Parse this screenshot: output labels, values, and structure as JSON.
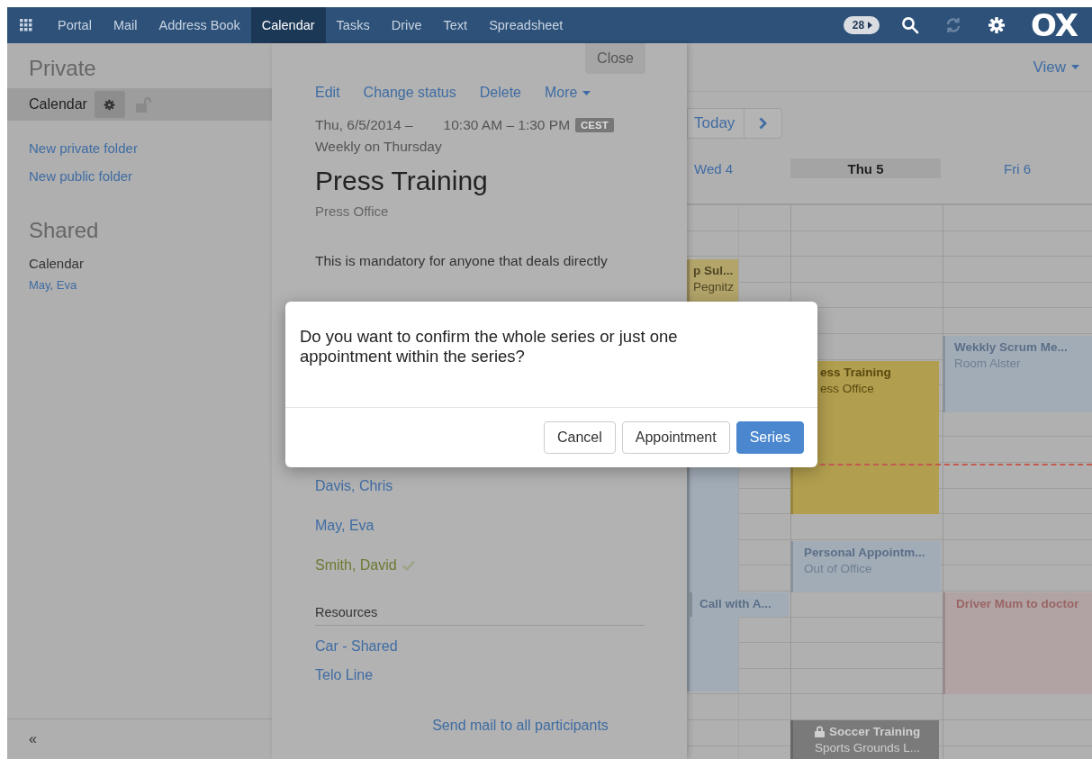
{
  "top_bar": {
    "apps": [
      {
        "label": "Portal",
        "selected": false
      },
      {
        "label": "Mail",
        "selected": false
      },
      {
        "label": "Address Book",
        "selected": false
      },
      {
        "label": "Calendar",
        "selected": true
      },
      {
        "label": "Tasks",
        "selected": false
      },
      {
        "label": "Drive",
        "selected": false
      },
      {
        "label": "Text",
        "selected": false
      },
      {
        "label": "Spreadsheet",
        "selected": false
      }
    ],
    "notification_count": "28",
    "logo": "OX"
  },
  "sidebar": {
    "private": {
      "title": "Private",
      "folder": {
        "label": "Calendar",
        "selected": true
      },
      "links": [
        "New private folder",
        "New public folder"
      ]
    },
    "shared": {
      "title": "Shared",
      "folder": "Calendar",
      "users": [
        "May, Eva"
      ]
    },
    "collapse": "«"
  },
  "detail": {
    "close": "Close",
    "actions": [
      "Edit",
      "Change status",
      "Delete",
      "More"
    ],
    "date": "Thu, 6/5/2014 –",
    "time": "10:30 AM – 1:30 PM",
    "timezone": "CEST",
    "recurrence": "Weekly on Thursday",
    "title": "Press Training",
    "location": "Press Office",
    "description": "This is mandatory for anyone that deals directly",
    "participants": [
      {
        "name": "Davis, Chris",
        "accepted": false
      },
      {
        "name": "May, Eva",
        "accepted": false
      },
      {
        "name": "Smith, David",
        "accepted": true
      }
    ],
    "resources_heading": "Resources",
    "resources": [
      "Car - Shared",
      "Telo Line"
    ],
    "send_mail": "Send mail to all participants"
  },
  "calendar": {
    "view": "View",
    "today": "Today",
    "days": [
      {
        "label": "Wed 4",
        "selected": false
      },
      {
        "label": "Thu 5",
        "selected": true
      },
      {
        "label": "Fri 6",
        "selected": false
      }
    ],
    "events": [
      {
        "title": "p Sul...",
        "subtitle": "Pegnitz",
        "color": "#b3a46a"
      },
      {
        "color": "#a2acb7"
      },
      {
        "title": "Call with A...",
        "color": "#a2acb7"
      },
      {
        "title": "ess Training",
        "subtitle": "ess Office",
        "color": "#b19e4e"
      },
      {
        "title": "Personal Appointm...",
        "subtitle": "Out of Office",
        "color": "#a2acb7"
      },
      {
        "title": "Soccer Training",
        "subtitle": "Sports Grounds L...",
        "color": "#7a7a7a",
        "locked": true
      },
      {
        "title": "Wekkly Scrum Me...",
        "subtitle": "Room Alster",
        "color": "#a2acb7"
      },
      {
        "title": "Driver Mum to doctor",
        "color": "#b1a3a3"
      }
    ]
  },
  "dialog": {
    "message": "Do you want to confirm the whole series or just one appointment within the series?",
    "buttons": [
      {
        "label": "Cancel",
        "kind": "default"
      },
      {
        "label": "Appointment",
        "kind": "default"
      },
      {
        "label": "Series",
        "kind": "primary"
      }
    ]
  }
}
